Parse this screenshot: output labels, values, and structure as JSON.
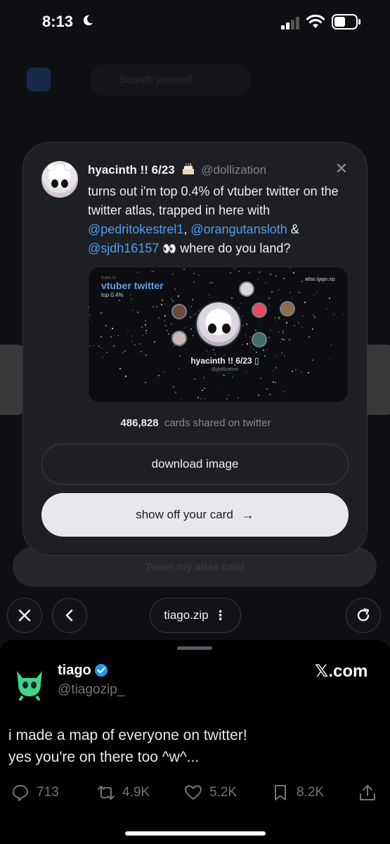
{
  "status": {
    "time": "8:13"
  },
  "background": {
    "search_placeholder": "Search yourself",
    "tweet_button": "Tweet my atlas card"
  },
  "modal": {
    "name": "hyacinth !! 6/23",
    "handle": "@dollization",
    "text_part1": "turns out i'm top 0.4% of vtuber twitter on the twitter atlas, trapped in here with ",
    "mention1": "@pedritokestrel1",
    "sep1": ", ",
    "mention2": "@orangutansloth",
    "sep2": " & ",
    "mention3": "@sjdh16157",
    "text_part2": " where do you land?",
    "preview": {
      "lives_in": "lives in",
      "community": "vtuber twitter",
      "rank": "top 0.4%",
      "site": "atlas.tiago.zip",
      "name": "hyacinth !! 6/23 ▯",
      "handle": "@dollization"
    },
    "cards_count": "486,828",
    "cards_label": "cards shared on twitter",
    "download_label": "download image",
    "show_label": "show off your card"
  },
  "browser": {
    "url": "tiago.zip"
  },
  "tweet": {
    "name": "tiago",
    "handle": "@tiagozip_",
    "source": "𝕏.com",
    "text_line1": "i made a map of everyone on twitter!",
    "text_line2": "yes you're on there too ^w^...",
    "replies": "713",
    "retweets": "4.9K",
    "likes": "5.2K",
    "bookmarks": "8.2K"
  }
}
